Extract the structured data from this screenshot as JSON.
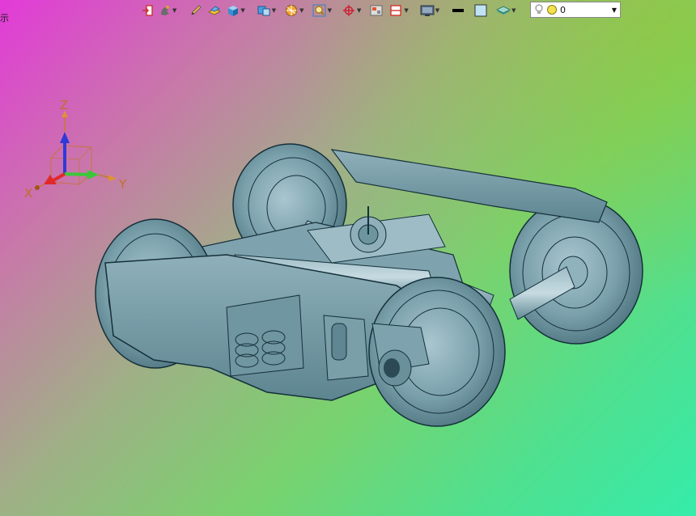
{
  "corner_label": "示",
  "toolbar": {
    "items": [
      {
        "icon": "exit-icon"
      },
      {
        "icon": "gesture-icon",
        "dropdown": true
      },
      {
        "icon": "pencil-icon"
      },
      {
        "icon": "surface-icon"
      },
      {
        "icon": "box-icon",
        "dropdown": true
      },
      {
        "icon": "shaded-cube-icon",
        "dropdown": true
      },
      {
        "icon": "sphere-icon",
        "dropdown": true
      },
      {
        "icon": "zoom-icon",
        "dropdown": true
      },
      {
        "icon": "datum-plane-icon",
        "dropdown": true
      },
      {
        "icon": "section-view-icon"
      },
      {
        "icon": "clip-view-icon",
        "dropdown": true
      },
      {
        "icon": "display-mode-icon",
        "dropdown": true
      },
      {
        "icon": "line-color-icon"
      },
      {
        "icon": "fill-color-icon"
      },
      {
        "icon": "layer-icon",
        "dropdown": true
      }
    ],
    "combo_value": "0"
  },
  "triad": {
    "z_label": "Z",
    "y_label": "Y",
    "x_label": "X"
  },
  "colors": {
    "model": "#6e97a2",
    "edges": "#15303a"
  }
}
